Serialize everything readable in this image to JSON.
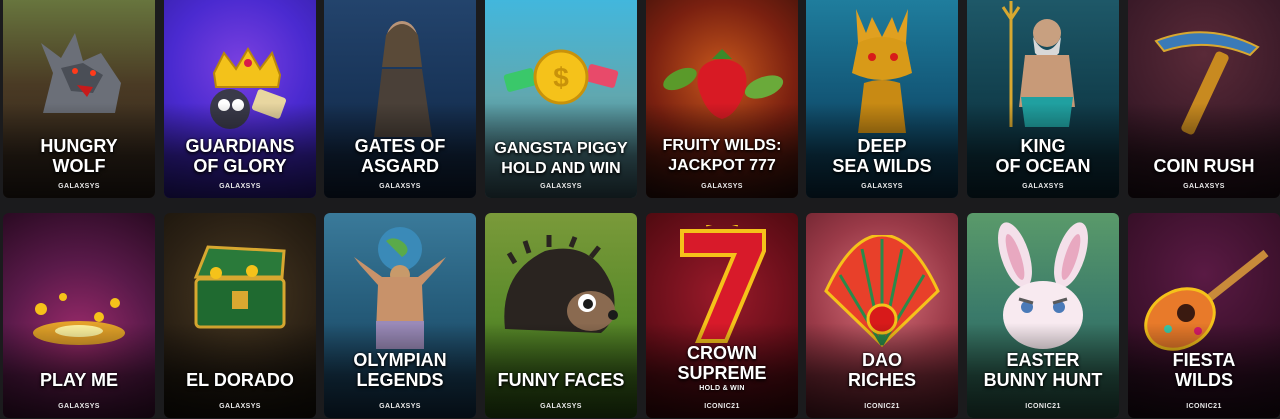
{
  "games": [
    {
      "title": "HUNGRY\nWOLF",
      "provider": "GALAXSYS",
      "icon": "wolf-icon",
      "bg": [
        "#5a6a3a",
        "#3a3426",
        "#2a1f18"
      ]
    },
    {
      "title": "GUARDIANS\nOF GLORY",
      "provider": "GALAXSYS",
      "icon": "crown-raccoon-icon",
      "bg": [
        "#3c3cc8",
        "#6a2fd0",
        "#4a1fa0"
      ]
    },
    {
      "title": "GATES OF\nASGARD",
      "provider": "GALAXSYS",
      "icon": "warrior-woman-icon",
      "bg": [
        "#1d3a5e",
        "#142a48",
        "#0f1f38"
      ]
    },
    {
      "title": "GANGSTA PIGGY\nHOLD AND WIN",
      "provider": "GALAXSYS",
      "icon": "gold-coin-icon",
      "bg": [
        "#3fb4d8",
        "#5aa8b8",
        "#3f6a74"
      ]
    },
    {
      "title": "FRUITY WILDS:\nJACKPOT 777",
      "provider": "GALAXSYS",
      "icon": "strawberry-icon",
      "bg": [
        "#a8481c",
        "#6a1f10",
        "#2a0d08"
      ]
    },
    {
      "title": "DEEP\nSEA WILDS",
      "provider": "GALAXSYS",
      "icon": "dragon-icon",
      "bg": [
        "#1c6a8a",
        "#124a6a",
        "#0a2f48"
      ]
    },
    {
      "title": "KING\nOF OCEAN",
      "provider": "GALAXSYS",
      "icon": "poseidon-icon",
      "bg": [
        "#1a4a5a",
        "#0f3a48",
        "#0a2a38"
      ]
    },
    {
      "title": "COIN RUSH",
      "provider": "GALAXSYS",
      "icon": "pickaxe-icon",
      "bg": [
        "#3a1a2a",
        "#4a1f28",
        "#2a1018"
      ]
    },
    {
      "title": "PLAY ME",
      "provider": "GALAXSYS",
      "icon": "gold-burst-icon",
      "bg": [
        "#3a1438",
        "#7a1f5a",
        "#4a0f3a"
      ]
    },
    {
      "title": "EL DORADO",
      "provider": "GALAXSYS",
      "icon": "treasure-chest-icon",
      "bg": [
        "#3a2a1a",
        "#2a1f10",
        "#1a1208"
      ]
    },
    {
      "title": "OLYMPIAN\nLEGENDS",
      "provider": "GALAXSYS",
      "icon": "atlas-icon",
      "bg": [
        "#2a5a7a",
        "#1f4a6a",
        "#143450"
      ]
    },
    {
      "title": "FUNNY FACES",
      "provider": "GALAXSYS",
      "icon": "hedgehog-icon",
      "bg": [
        "#6a8a2a",
        "#4a7a1f",
        "#2f5a14"
      ]
    },
    {
      "title": "CROWN\nSUPREME",
      "subtitle": "HOLD & WIN",
      "provider": "ICONIC21",
      "icon": "red-seven-icon",
      "bg": [
        "#7a0f1f",
        "#5a0a14",
        "#3a0608"
      ]
    },
    {
      "title": "DAO\nRICHES",
      "provider": "ICONIC21",
      "icon": "fan-icon",
      "bg": [
        "#b8505a",
        "#8a2a38",
        "#5a1a24"
      ]
    },
    {
      "title": "EASTER\nBUNNY HUNT",
      "provider": "ICONIC21",
      "icon": "bunny-icon",
      "bg": [
        "#4a8a5a",
        "#3a7a6a",
        "#2a5a4a"
      ]
    },
    {
      "title": "FIESTA\nWILDS",
      "provider": "ICONIC21",
      "icon": "guitar-icon",
      "bg": [
        "#4a1438",
        "#3a102a",
        "#220a18"
      ]
    }
  ]
}
